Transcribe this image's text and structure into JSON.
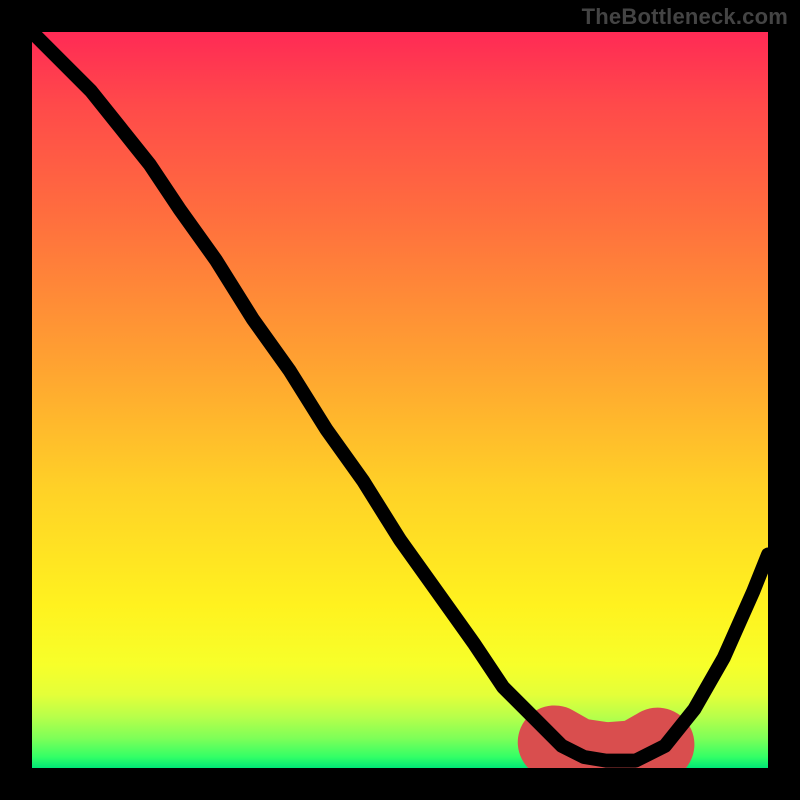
{
  "watermark": "TheBottleneck.com",
  "chart_data": {
    "type": "line",
    "title": "",
    "xlabel": "",
    "ylabel": "",
    "xlim": [
      0,
      100
    ],
    "ylim": [
      0,
      100
    ],
    "legend": false,
    "grid": false,
    "background_gradient": {
      "top": "#ff2a55",
      "mid": "#ffd127",
      "bottom": "#00e676"
    },
    "series": [
      {
        "name": "bottleneck-curve",
        "x": [
          0,
          4,
          8,
          12,
          16,
          20,
          25,
          30,
          35,
          40,
          45,
          50,
          55,
          60,
          64,
          68,
          72,
          75,
          78,
          82,
          86,
          90,
          94,
          98,
          100
        ],
        "y": [
          100,
          96,
          92,
          87,
          82,
          76,
          69,
          61,
          54,
          46,
          39,
          31,
          24,
          17,
          11,
          7,
          3,
          1.5,
          1,
          1,
          3,
          8,
          15,
          24,
          29
        ]
      }
    ],
    "accent_segment": {
      "name": "flat-bottom-highlight",
      "color": "#d94e4e",
      "x": [
        71,
        74,
        78,
        82,
        85
      ],
      "y": [
        3.5,
        1.8,
        1.2,
        1.5,
        3.2
      ]
    }
  }
}
